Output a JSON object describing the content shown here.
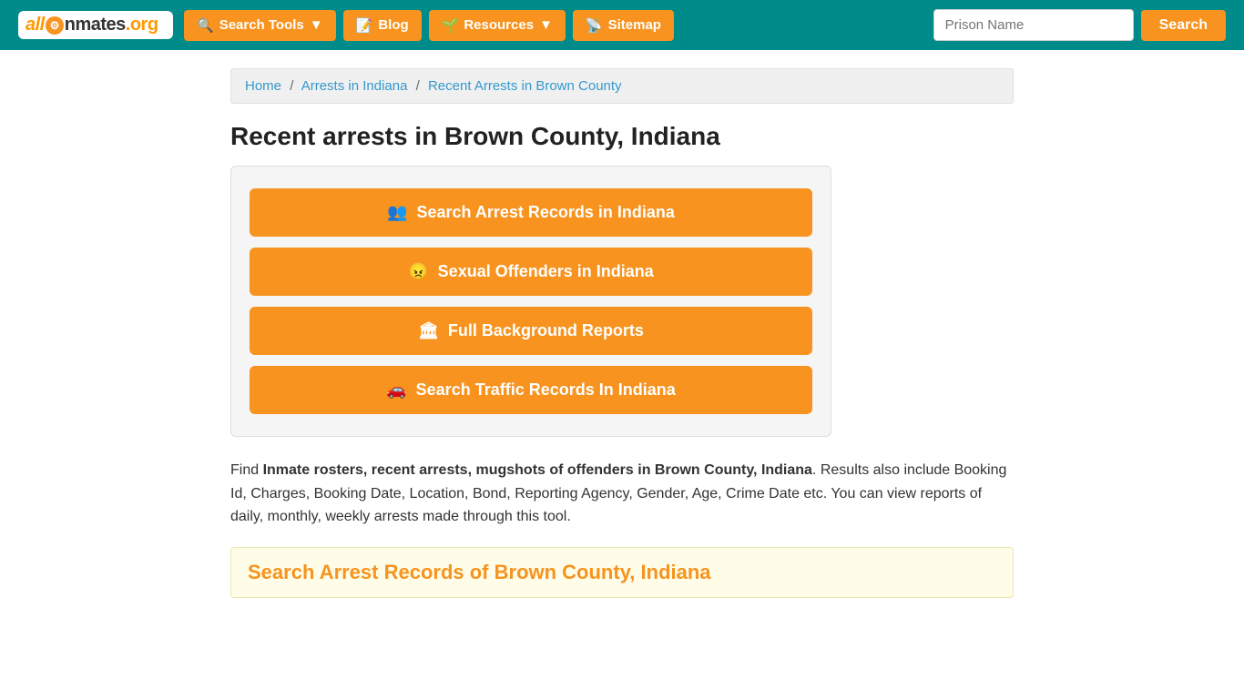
{
  "header": {
    "logo": {
      "text_all": "all",
      "text_inmates": "Inmates",
      "text_org": ".org"
    },
    "nav": {
      "search_tools_label": "Search Tools",
      "blog_label": "Blog",
      "resources_label": "Resources",
      "sitemap_label": "Sitemap"
    },
    "search": {
      "placeholder": "Prison Name",
      "button_label": "Search"
    }
  },
  "breadcrumb": {
    "home_label": "Home",
    "arrests_indiana_label": "Arrests in Indiana",
    "current_label": "Recent Arrests in Brown County"
  },
  "page": {
    "title": "Recent arrests in Brown County, Indiana",
    "buttons": [
      {
        "id": "arrest-records",
        "icon": "👥",
        "label": "Search Arrest Records in Indiana"
      },
      {
        "id": "sexual-offenders",
        "icon": "😠",
        "label": "Sexual Offenders in Indiana"
      },
      {
        "id": "background-reports",
        "icon": "🏛",
        "label": "Full Background Reports"
      },
      {
        "id": "traffic-records",
        "icon": "🚗",
        "label": "Search Traffic Records In Indiana"
      }
    ],
    "description_prefix": "Find ",
    "description_bold": "Inmate rosters, recent arrests, mugshots of offenders in Brown County, Indiana",
    "description_suffix": ". Results also include Booking Id, Charges, Booking Date, Location, Bond, Reporting Agency, Gender, Age, Crime Date etc. You can view reports of daily, monthly, weekly arrests made through this tool.",
    "section_title": "Search Arrest Records of Brown County, Indiana"
  }
}
